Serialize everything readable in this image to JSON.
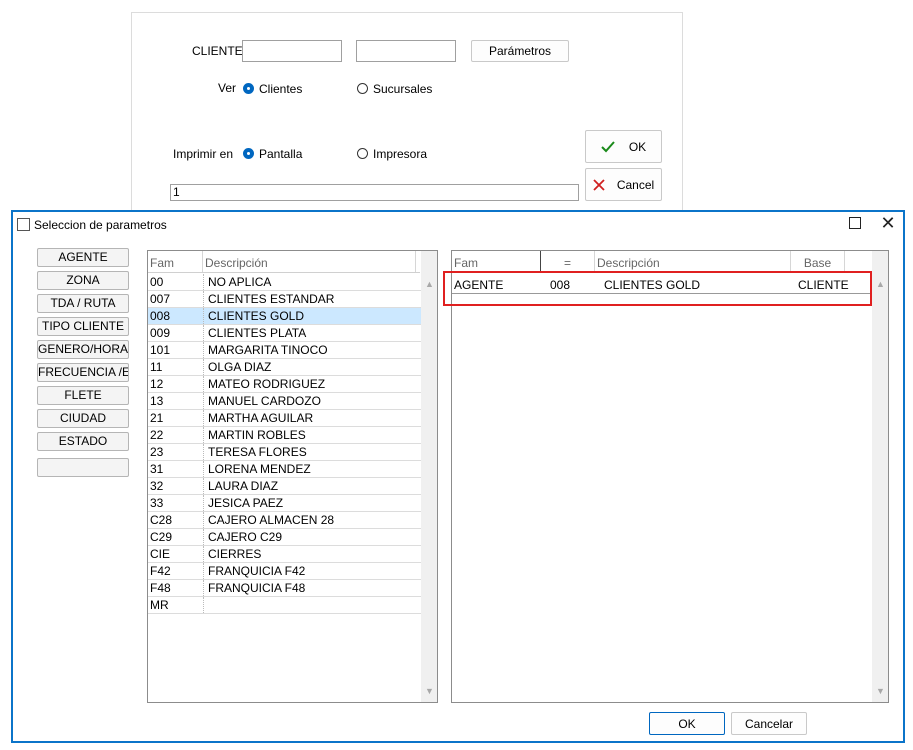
{
  "form": {
    "cliente_label": "CLIENTE",
    "cliente_value1": "",
    "cliente_value2": "",
    "parametros_label": "Parámetros",
    "ver_label": "Ver",
    "ver_options": [
      "Clientes",
      "Sucursales"
    ],
    "ver_selected": "Clientes",
    "imprimir_label": "Imprimir en",
    "imprimir_options": [
      "Pantalla",
      "Impresora"
    ],
    "imprimir_selected": "Pantalla",
    "copies_value": "1",
    "ok_label": "OK",
    "cancel_label": "Cancel",
    "ok_icon": "checkmark-icon",
    "cancel_icon": "x-icon"
  },
  "dialog": {
    "title": "Seleccion de parametros",
    "param_buttons": [
      "AGENTE",
      "ZONA",
      "TDA / RUTA",
      "TIPO CLIENTE",
      "GENERO/HORARIO",
      "FRECUENCIA /EDAD",
      "FLETE",
      "CIUDAD",
      "ESTADO",
      ""
    ],
    "left_grid": {
      "headers": [
        "Fam",
        "Descripción"
      ],
      "rows": [
        [
          "00",
          "NO APLICA"
        ],
        [
          "007",
          "CLIENTES ESTANDAR"
        ],
        [
          "008",
          "CLIENTES GOLD"
        ],
        [
          "009",
          "CLIENTES PLATA"
        ],
        [
          "101",
          "MARGARITA TINOCO"
        ],
        [
          "11",
          "OLGA DIAZ"
        ],
        [
          "12",
          "MATEO RODRIGUEZ"
        ],
        [
          "13",
          "MANUEL CARDOZO"
        ],
        [
          "21",
          "MARTHA AGUILAR"
        ],
        [
          "22",
          "MARTIN ROBLES"
        ],
        [
          "23",
          "TERESA FLORES"
        ],
        [
          "31",
          "LORENA MENDEZ"
        ],
        [
          "32",
          "LAURA DIAZ"
        ],
        [
          "33",
          "JESICA PAEZ"
        ],
        [
          "C28",
          "CAJERO ALMACEN 28"
        ],
        [
          "C29",
          "CAJERO C29"
        ],
        [
          "CIE",
          "CIERRES"
        ],
        [
          "F42",
          "FRANQUICIA F42"
        ],
        [
          "F48",
          "FRANQUICIA F48"
        ],
        [
          "MR",
          ""
        ]
      ],
      "selected_row": "008"
    },
    "right_grid": {
      "headers": [
        "Fam",
        "=",
        "Descripción",
        "Base"
      ],
      "rows": [
        [
          "AGENTE",
          "008",
          "CLIENTES GOLD",
          "CLIENTE"
        ]
      ]
    },
    "ok_label": "OK",
    "cancel_label": "Cancelar",
    "colors": {
      "border": "#0b74c9",
      "selection": "#cce8ff",
      "highlight": "#e02020",
      "radio": "#0067c0"
    }
  }
}
